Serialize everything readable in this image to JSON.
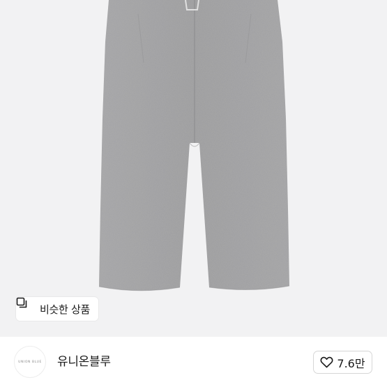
{
  "product": {
    "image_subject": "gray wide-leg sweatpants",
    "similar_products_label": "비슷한 상품"
  },
  "shop": {
    "logo_text": "UNION BLUE",
    "name": "유니온블루",
    "likes": "7.6만"
  },
  "colors": {
    "image_background": "#f2f2f3",
    "pants_gray": "#9d9d9f",
    "text": "#1a1a1a",
    "border": "#d6d6d6"
  },
  "icons": {
    "similar": "similar-products-icon",
    "like": "heart-outline-icon"
  }
}
